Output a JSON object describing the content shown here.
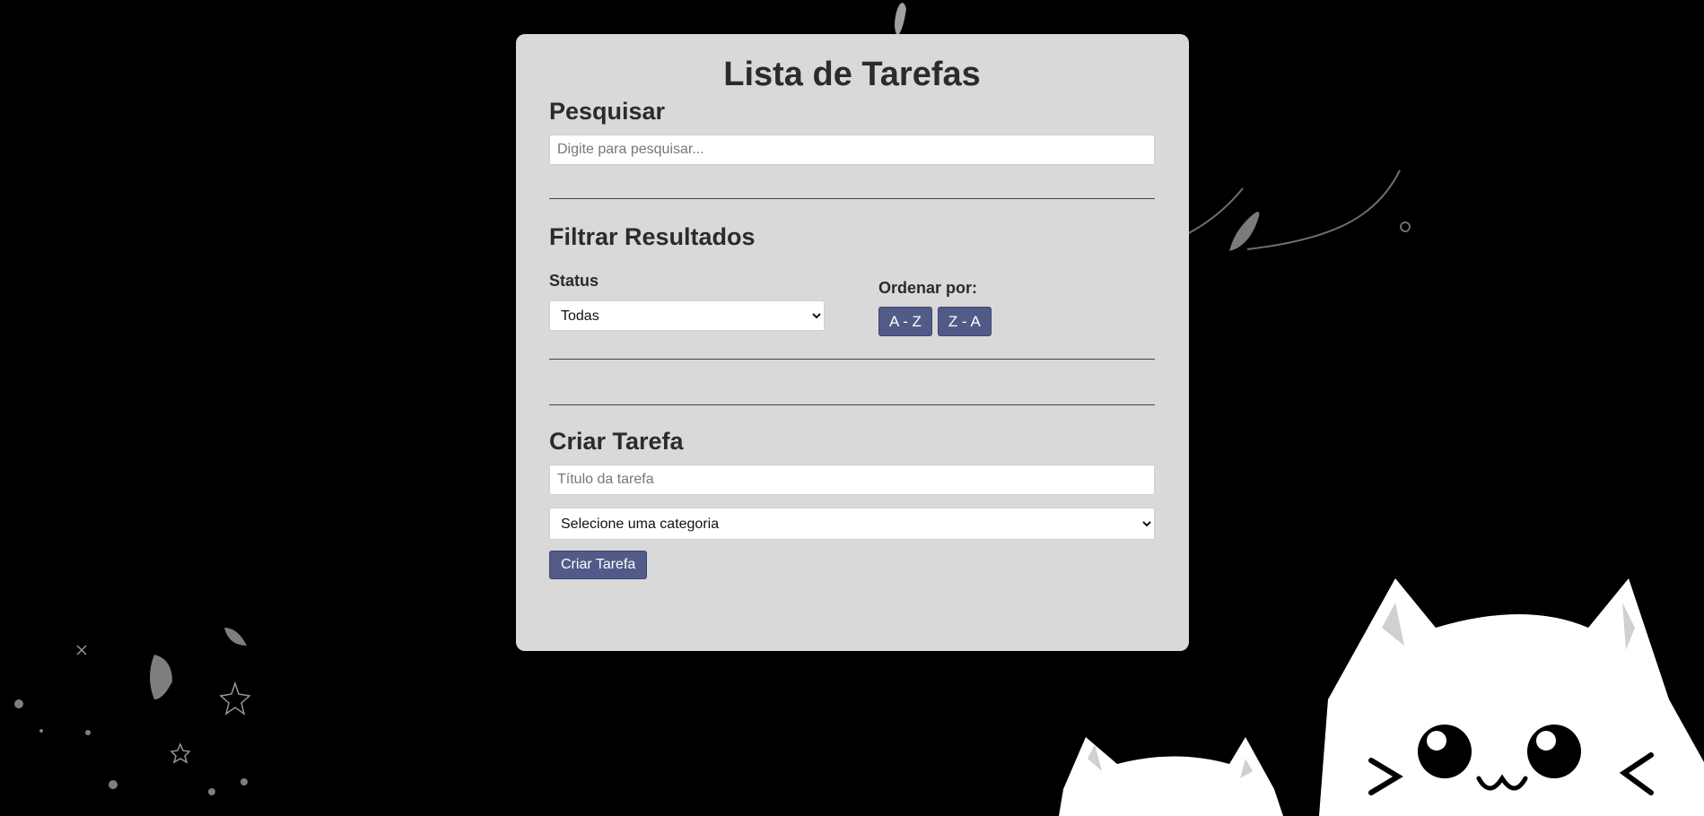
{
  "page": {
    "title": "Lista de Tarefas"
  },
  "search": {
    "heading": "Pesquisar",
    "placeholder": "Digite para pesquisar..."
  },
  "filter": {
    "heading": "Filtrar Resultados",
    "status_label": "Status",
    "status_selected": "Todas",
    "sort_label": "Ordenar por:",
    "sort_az_label": "A - Z",
    "sort_za_label": "Z - A"
  },
  "create": {
    "heading": "Criar Tarefa",
    "title_placeholder": "Título da tarefa",
    "category_selected": "Selecione uma categoria",
    "submit_label": "Criar Tarefa"
  },
  "colors": {
    "background": "#000000",
    "card": "#d9d9d9",
    "accent_button": "#525b87",
    "heading_text": "#2b2b2b"
  },
  "decor": {
    "background_art": "cat-faces-and-leaves-illustration"
  }
}
